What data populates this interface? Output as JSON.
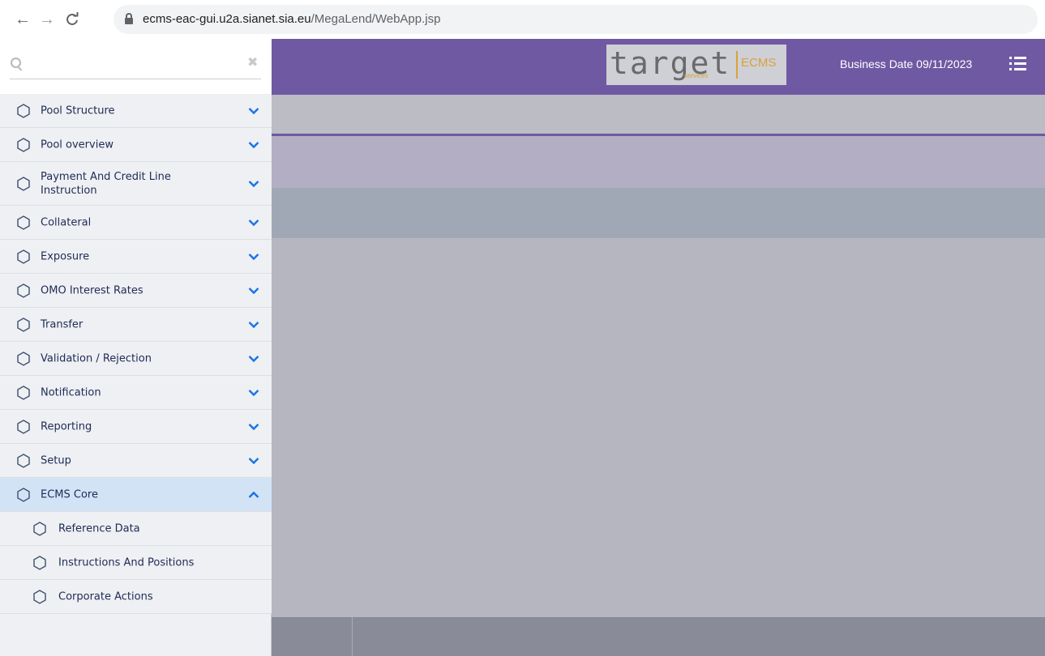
{
  "browser": {
    "url_host": "ecms-eac-gui.u2a.sianet.sia.eu",
    "url_path": "/MegaLend/WebApp.jsp",
    "back_icon": "←",
    "forward_icon": "→",
    "reload_icon": "C"
  },
  "header": {
    "logo_main": "target",
    "logo_sub": "services",
    "logo_product": "ECMS",
    "business_date": "Business Date 09/11/2023",
    "accent_color": "#7059a3"
  },
  "sidebar": {
    "search": {
      "placeholder": "",
      "value": ""
    },
    "clear_icon": "✖",
    "items": [
      {
        "label": "Pool Structure",
        "state": "collapsed"
      },
      {
        "label": "Pool overview",
        "state": "collapsed"
      },
      {
        "label": "Payment And Credit Line Instruction",
        "state": "collapsed"
      },
      {
        "label": "Collateral",
        "state": "collapsed"
      },
      {
        "label": "Exposure",
        "state": "collapsed"
      },
      {
        "label": "OMO Interest Rates",
        "state": "collapsed"
      },
      {
        "label": "Transfer",
        "state": "collapsed"
      },
      {
        "label": "Validation / Rejection",
        "state": "collapsed"
      },
      {
        "label": "Notification",
        "state": "collapsed"
      },
      {
        "label": "Reporting",
        "state": "collapsed"
      },
      {
        "label": "Setup",
        "state": "collapsed"
      },
      {
        "label": "ECMS Core",
        "state": "expanded"
      }
    ],
    "subitems": [
      {
        "label": "Reference Data"
      },
      {
        "label": "Instructions And Positions"
      },
      {
        "label": "Corporate Actions"
      }
    ]
  }
}
